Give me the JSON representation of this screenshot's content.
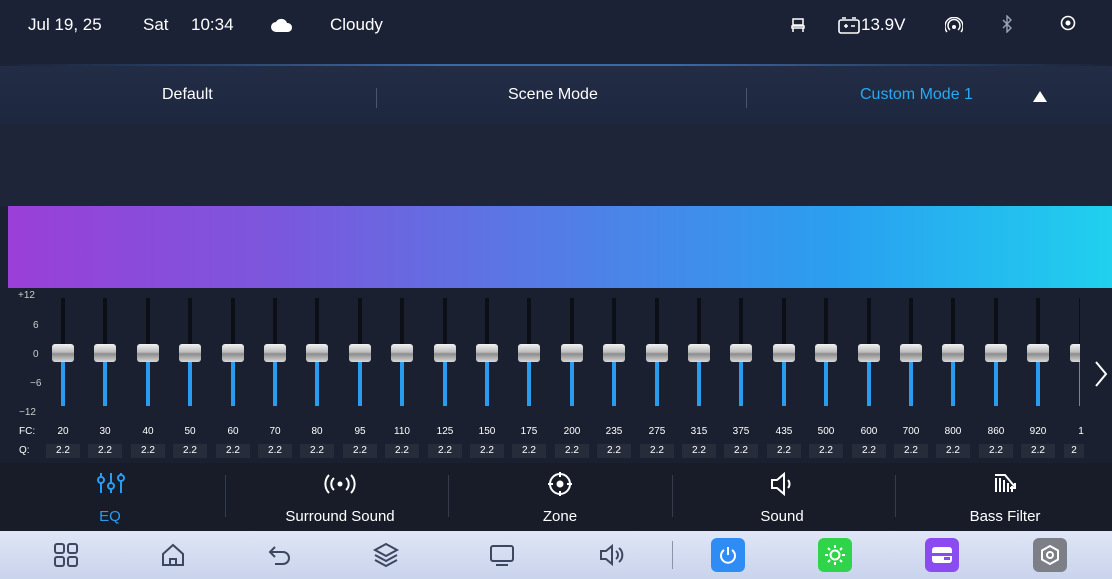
{
  "status": {
    "date": "Jul 19, 25",
    "day": "Sat",
    "time": "10:34",
    "weather": "Cloudy",
    "voltage": "13.9V",
    "icons": [
      "cloud-icon",
      "seat-icon",
      "battery-icon",
      "hotspot-icon",
      "bluetooth-icon",
      "location-icon"
    ]
  },
  "modes": {
    "default": "Default",
    "scene": "Scene Mode",
    "custom": "Custom Mode 1"
  },
  "scale": {
    "p12": "+12",
    "p6": "6",
    "z": "0",
    "m6": "−6",
    "m12": "−12"
  },
  "labels": {
    "fc": "FC:",
    "q": "Q:"
  },
  "bands": {
    "fc": [
      "20",
      "30",
      "40",
      "50",
      "60",
      "70",
      "80",
      "95",
      "110",
      "125",
      "150",
      "175",
      "200",
      "235",
      "275",
      "315",
      "375",
      "435",
      "500",
      "600",
      "700",
      "800",
      "860",
      "920",
      "1"
    ],
    "q": [
      "2.2",
      "2.2",
      "2.2",
      "2.2",
      "2.2",
      "2.2",
      "2.2",
      "2.2",
      "2.2",
      "2.2",
      "2.2",
      "2.2",
      "2.2",
      "2.2",
      "2.2",
      "2.2",
      "2.2",
      "2.2",
      "2.2",
      "2.2",
      "2.2",
      "2.2",
      "2.2",
      "2.2",
      "2"
    ],
    "gain": [
      0,
      0,
      0,
      0,
      0,
      0,
      0,
      0,
      0,
      0,
      0,
      0,
      0,
      0,
      0,
      0,
      0,
      0,
      0,
      0,
      0,
      0,
      0,
      0,
      0
    ]
  },
  "tabs": {
    "eq": "EQ",
    "surround": "Surround Sound",
    "zone": "Zone",
    "sound": "Sound",
    "bass": "Bass Filter"
  },
  "colors": {
    "accent": "#2a9cf0",
    "power": "#2f8cf5",
    "brightness": "#2fd44a",
    "card": "#8a4cf0",
    "settings": "#7c7f86"
  }
}
